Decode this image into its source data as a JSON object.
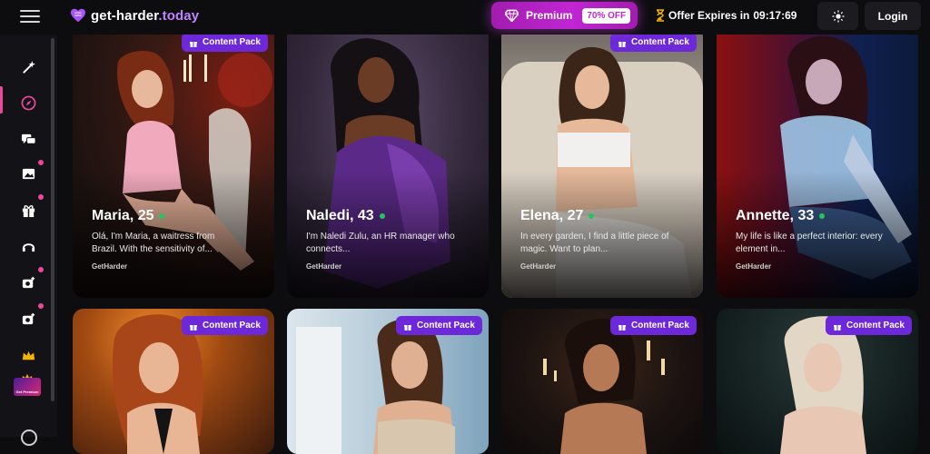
{
  "header": {
    "logo_prefix": "get-harder",
    "logo_tld": ".today",
    "premium_label": "Premium",
    "discount_badge": "70% OFF",
    "offer_label": "Offer Expires in",
    "offer_time": "09:17:69",
    "login_label": "Login"
  },
  "sidebar": {
    "items": [
      {
        "icon": "magic-wand-icon"
      },
      {
        "icon": "compass-icon",
        "active": true
      },
      {
        "icon": "chat-icon"
      },
      {
        "icon": "image-icon",
        "badge": true
      },
      {
        "icon": "gift-icon",
        "badge": true
      },
      {
        "icon": "headset-icon"
      },
      {
        "icon": "camera-plus-icon",
        "badge": true
      },
      {
        "icon": "camera-add-icon",
        "badge": true
      },
      {
        "icon": "crown-icon"
      }
    ],
    "promo_label": "Get Premium"
  },
  "cards": [
    {
      "badge": "Content Pack",
      "name": "Maria, 25",
      "desc": "Olá, I'm Maria, a waitress from Brazil. With the sensitivity of...",
      "brand": "GetHarder"
    },
    {
      "badge": "",
      "name": "Naledi, 43",
      "desc": "I'm Naledi Zulu, an HR manager who connects...",
      "brand": "GetHarder"
    },
    {
      "badge": "Content Pack",
      "name": "Elena, 27",
      "desc": "In every garden, I find a little piece of magic. Want to plan...",
      "brand": "GetHarder"
    },
    {
      "badge": "",
      "name": "Annette, 33",
      "desc": "My life is like a perfect interior: every element in...",
      "brand": "GetHarder"
    },
    {
      "badge": "Content Pack"
    },
    {
      "badge": "Content Pack"
    },
    {
      "badge": "Content Pack"
    },
    {
      "badge": "Content Pack"
    }
  ],
  "colors": {
    "accent": "#c026d3",
    "badge": "#6d28d9",
    "online": "#22c55e",
    "active": "#ec4899"
  }
}
